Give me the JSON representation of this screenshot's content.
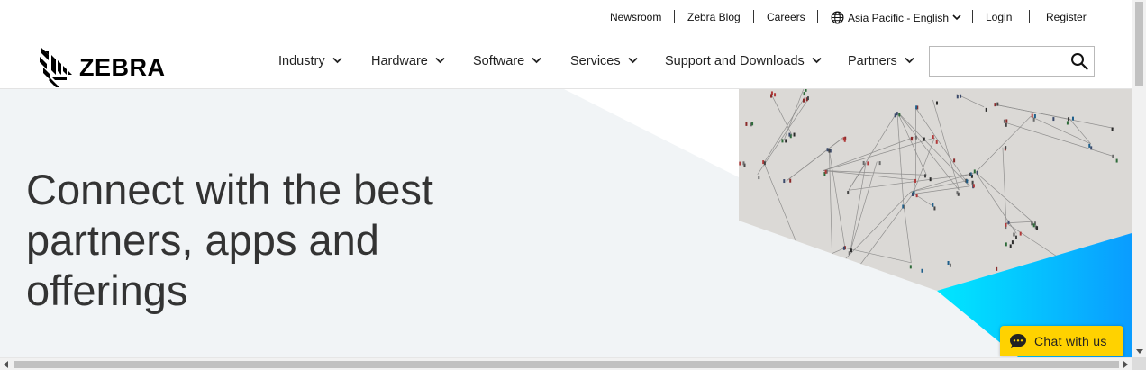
{
  "utility_nav": {
    "newsroom": "Newsroom",
    "blog": "Zebra Blog",
    "careers": "Careers",
    "region": "Asia Pacific - English",
    "login": "Login",
    "register": "Register"
  },
  "brand": {
    "name": "ZEBRA"
  },
  "main_nav": {
    "items": [
      {
        "label": "Industry"
      },
      {
        "label": "Hardware"
      },
      {
        "label": "Software"
      },
      {
        "label": "Services"
      },
      {
        "label": "Support and Downloads"
      },
      {
        "label": "Partners"
      }
    ]
  },
  "search": {
    "placeholder": ""
  },
  "hero": {
    "title": "Connect with the best partners, apps and offerings"
  },
  "chat": {
    "label": "Chat with us"
  },
  "colors": {
    "hero_panel": "#f1f4f6",
    "accent_cyan": "#00e2ff",
    "accent_blue": "#0aa3ff",
    "chat_button": "#ffd200",
    "plaza": "#d7d5d1"
  }
}
